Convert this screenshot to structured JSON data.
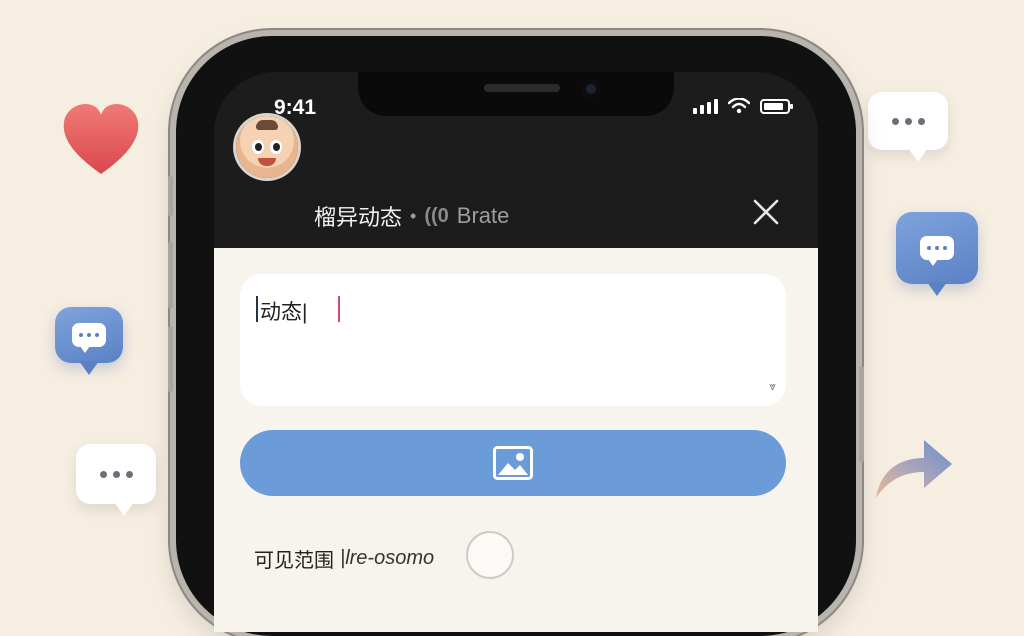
{
  "status_bar": {
    "time": "9:41"
  },
  "header": {
    "title": "榴异动态",
    "separator": "•",
    "brand_icon": "((0",
    "brand": "Brate"
  },
  "composer": {
    "text_value": "动态|",
    "visibility_label": "可见范围",
    "visibility_value": "|lre-osomo"
  },
  "icons": [
    "heart-icon",
    "chat-bubble-icon",
    "share-arrow-icon",
    "image-icon",
    "close-icon",
    "wifi-icon",
    "signal-icon",
    "battery-icon"
  ],
  "colors": {
    "accent_blue": "#6b9bd8",
    "background": "#f7eee2",
    "caret_pink": "#cc4d7a",
    "heart_red": "#e8585a"
  }
}
